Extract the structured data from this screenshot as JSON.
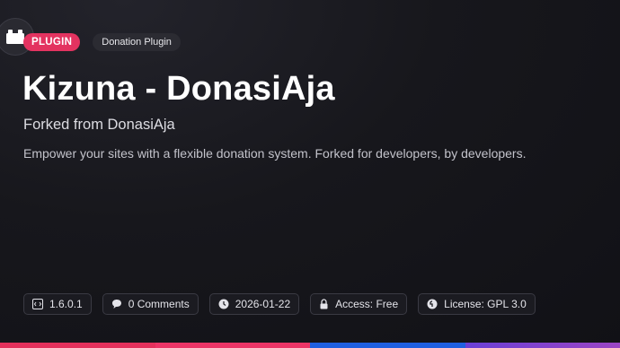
{
  "badges": {
    "type": "PLUGIN",
    "category": "Donation Plugin"
  },
  "title": "Kizuna - DonasiAja",
  "subtitle": "Forked from DonasiAja",
  "description": "Empower your sites with a flexible donation system. Forked for developers, by developers.",
  "meta": {
    "version": "1.6.0.1",
    "comments": "0 Comments",
    "date": "2026-01-22",
    "access": "Access: Free",
    "license": "License: GPL 3.0"
  },
  "icons": [
    "plugin-icon",
    "code-icon",
    "comment-icon",
    "clock-icon",
    "lock-icon",
    "license-icon"
  ],
  "colors": {
    "accent": "#e33360",
    "bar": [
      "#e3305b",
      "#ec3466",
      "#1f5fe0",
      "#8b3fc8"
    ]
  }
}
